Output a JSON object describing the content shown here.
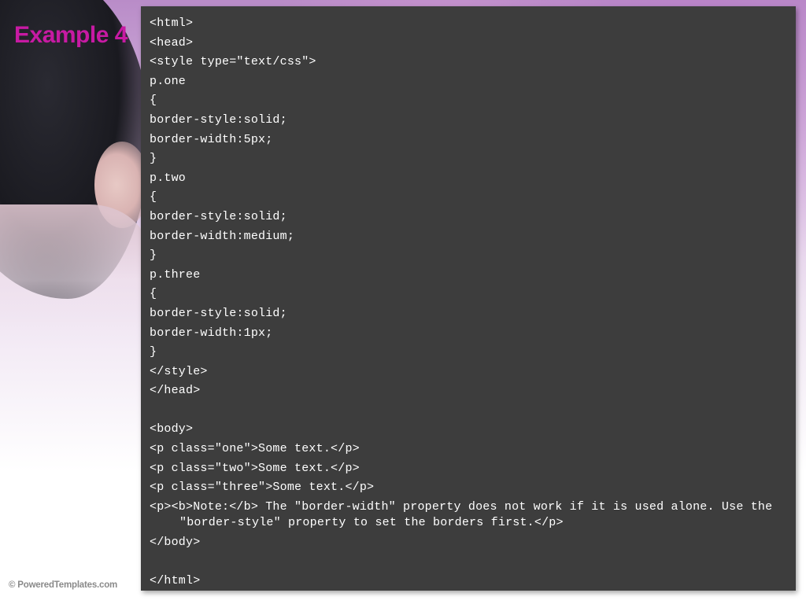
{
  "slide": {
    "title": "Example 4",
    "footer": "© PoweredTemplates.com"
  },
  "code_lines": [
    "<html>",
    "<head>",
    "<style type=\"text/css\">",
    "p.one",
    "{",
    "border-style:solid;",
    "border-width:5px;",
    "}",
    "p.two",
    "{",
    "border-style:solid;",
    "border-width:medium;",
    "}",
    "p.three",
    "{",
    "border-style:solid;",
    "border-width:1px;",
    "}",
    "</style>",
    "</head>",
    "",
    "<body>",
    "<p class=\"one\">Some text.</p>",
    "<p class=\"two\">Some text.</p>",
    "<p class=\"three\">Some text.</p>",
    "<p><b>Note:</b> The \"border-width\" property does not work if it is used alone. Use the \"border-style\" property to set the borders first.</p>",
    "</body>",
    "",
    "</html>"
  ]
}
